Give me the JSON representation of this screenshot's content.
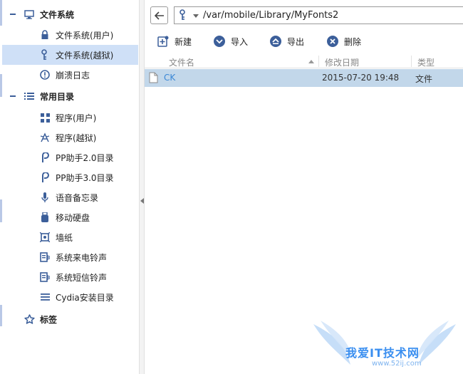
{
  "sidebar": {
    "sections": [
      {
        "label": "文件系统",
        "icon": "monitor-icon",
        "items": [
          {
            "label": "文件系统(用户)",
            "icon": "lock-icon"
          },
          {
            "label": "文件系统(越狱)",
            "icon": "key-icon",
            "selected": true
          },
          {
            "label": "崩溃日志",
            "icon": "alert-circle-icon"
          }
        ]
      },
      {
        "label": "常用目录",
        "icon": "list-icon",
        "items": [
          {
            "label": "程序(用户)",
            "icon": "apps-grid-icon"
          },
          {
            "label": "程序(越狱)",
            "icon": "cydia-app-icon"
          },
          {
            "label": "PP助手2.0目录",
            "icon": "pp-logo-icon"
          },
          {
            "label": "PP助手3.0目录",
            "icon": "pp-logo-icon"
          },
          {
            "label": "语音备忘录",
            "icon": "microphone-icon"
          },
          {
            "label": "移动硬盘",
            "icon": "usb-drive-icon"
          },
          {
            "label": "墙纸",
            "icon": "wallpaper-icon"
          },
          {
            "label": "系统来电铃声",
            "icon": "ringtone-icon"
          },
          {
            "label": "系统短信铃声",
            "icon": "sms-tone-icon"
          },
          {
            "label": "Cydia安装目录",
            "icon": "menu-lines-icon"
          }
        ]
      },
      {
        "label": "标签",
        "icon": "star-icon",
        "items": []
      }
    ]
  },
  "address": {
    "path": "/var/mobile/Library/MyFonts2",
    "location_icon": "key-icon"
  },
  "toolbar": {
    "new_label": "新建",
    "import_label": "导入",
    "export_label": "导出",
    "delete_label": "删除"
  },
  "list": {
    "columns": {
      "name": "文件名",
      "modified": "修改日期",
      "type": "类型"
    },
    "rows": [
      {
        "name": "CK",
        "modified": "2015-07-20 19:48",
        "type": "文件"
      }
    ]
  },
  "watermark": {
    "text": "我爱IT技术网",
    "url": "www.52ij.com"
  },
  "colors": {
    "selected_bg": "#cfe0f7",
    "row_selected_bg": "#c2d7ea",
    "accent": "#3c5f9a",
    "link": "#3a87d6"
  }
}
